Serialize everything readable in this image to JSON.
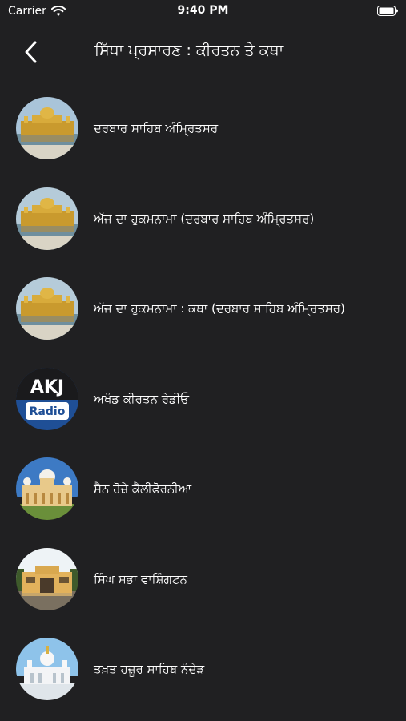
{
  "status_bar": {
    "carrier": "Carrier",
    "time": "9:40 PM"
  },
  "nav": {
    "title": "ਸਿੱਧਾ ਪ੍ਰਸਾਰਣ : ਕੀਰਤਨ ਤੇ ਕਥਾ"
  },
  "akj_logo": {
    "top": "AKJ",
    "bottom": "Radio"
  },
  "channels": [
    {
      "label": "ਦਰਬਾਰ ਸਾਹਿਬ ਅੰਮ੍ਰਿਤਸਰ",
      "thumb": "golden-temple"
    },
    {
      "label": "ਅੱਜ ਦਾ ਹੁਕਮਨਾਮਾ (ਦਰਬਾਰ ਸਾਹਿਬ ਅੰਮ੍ਰਿਤਸਰ)",
      "thumb": "golden-temple"
    },
    {
      "label": "ਅੱਜ ਦਾ ਹੁਕਮਨਾਮਾ : ਕਥਾ  (ਦਰਬਾਰ ਸਾਹਿਬ ਅੰਮ੍ਰਿਤਸਰ)",
      "thumb": "golden-temple"
    },
    {
      "label": "ਅਖੰਡ ਕੀਰਤਨ ਰੇਡੀਓ",
      "thumb": "akj-radio"
    },
    {
      "label": "ਸੈਨ ਹੋਜ਼ੇ ਕੈਲੀਫੋਰਨੀਆ",
      "thumb": "san-jose-gurdwara"
    },
    {
      "label": "ਸਿੰਘ ਸਭਾ ਵਾਸ਼ਿੰਗਟਨ",
      "thumb": "washington-gurdwara"
    },
    {
      "label": "ਤਖ਼ਤ ਹਜ਼ੂਰ ਸਾਹਿਬ ਨੰਦੇੜ",
      "thumb": "hazur-sahib"
    }
  ],
  "colors": {
    "background": "#202022",
    "text": "#ffffff",
    "akj_blue": "#1f4f96"
  }
}
